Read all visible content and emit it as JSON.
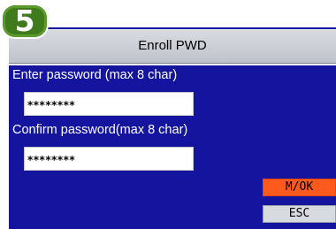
{
  "step_badge": "5",
  "window": {
    "title": "Enroll PWD"
  },
  "form": {
    "password_label": "Enter password (max 8 char)",
    "password_value": "********",
    "confirm_label": "Confirm password(max 8 char)",
    "confirm_value": "********"
  },
  "buttons": {
    "ok_label": "M/OK",
    "esc_label": "ESC"
  },
  "colors": {
    "screen_bg": "#14149e",
    "titlebar": "#c9ccd2",
    "ok_button": "#ff5a1e",
    "badge": "#3f7a1c"
  }
}
